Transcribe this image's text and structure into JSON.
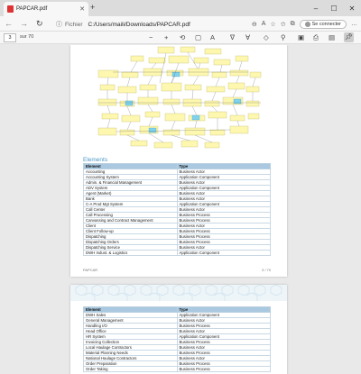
{
  "tab": {
    "title": "PAPCAR.pdf"
  },
  "address": {
    "scheme_label": "Fichier",
    "url": "C:/Users/maili/Downloads/PAPCAR.pdf",
    "signin_label": "Se connecter"
  },
  "pdf_toolbar": {
    "current_page": "3",
    "page_total": "sur 70"
  },
  "page1": {
    "section_title": "Elements",
    "columns": [
      "Element",
      "Type"
    ],
    "rows": [
      [
        "Accounting",
        "Business Actor"
      ],
      [
        "Accounting System",
        "Application Component"
      ],
      [
        "Admin. & Financial Management",
        "Business Actor"
      ],
      [
        "ADV System",
        "Application Component"
      ],
      [
        "Agent (Market)",
        "Business Actor"
      ],
      [
        "Bank",
        "Business Actor"
      ],
      [
        "C-A Prod Mgt System",
        "Application Component"
      ],
      [
        "Call Center",
        "Business Actor"
      ],
      [
        "Call Processing",
        "Business Process"
      ],
      [
        "Canvassing and Contract Management",
        "Business Process"
      ],
      [
        "Client",
        "Business Actor"
      ],
      [
        "Client Follow-up",
        "Business Process"
      ],
      [
        "Dispatching",
        "Business Process"
      ],
      [
        "Dispatching Orders",
        "Business Process"
      ],
      [
        "Dispatching Service",
        "Business Actor"
      ],
      [
        "DWH Indust. & Logistics",
        "Application Component"
      ]
    ],
    "footer_left": "PAPCAR",
    "footer_right": "3 / 70"
  },
  "page2": {
    "columns": [
      "Element",
      "Type"
    ],
    "rows": [
      [
        "DWH Sales",
        "Application Component"
      ],
      [
        "General Management",
        "Business Actor"
      ],
      [
        "Handling I/O",
        "Business Process"
      ],
      [
        "Head Office",
        "Business Actor"
      ],
      [
        "HR System",
        "Application Component"
      ],
      [
        "Invoicing Collection",
        "Business Process"
      ],
      [
        "Local Haulage Contractors",
        "Business Actor"
      ],
      [
        "Material Planning Needs",
        "Business Process"
      ],
      [
        "National Haulage Contractors",
        "Business Actor"
      ],
      [
        "Order Preparation",
        "Business Process"
      ],
      [
        "Order Taking",
        "Business Process"
      ]
    ]
  },
  "icons": {
    "newtab": "plus-icon",
    "back": "back-arrow-icon",
    "forward": "forward-arrow-icon",
    "refresh": "refresh-icon",
    "info": "info-icon",
    "zoom": "zoom-icon",
    "read_aloud": "read-aloud-icon",
    "favorites": "star-icon",
    "collections": "collections-icon",
    "profile": "profile-icon",
    "menu": "more-icon"
  },
  "colors": {
    "accent": "#4c98c7",
    "table_header": "#aac9e0",
    "diagram_box": "#fdf7b0",
    "diagram_highlight": "#7fd3ef"
  }
}
